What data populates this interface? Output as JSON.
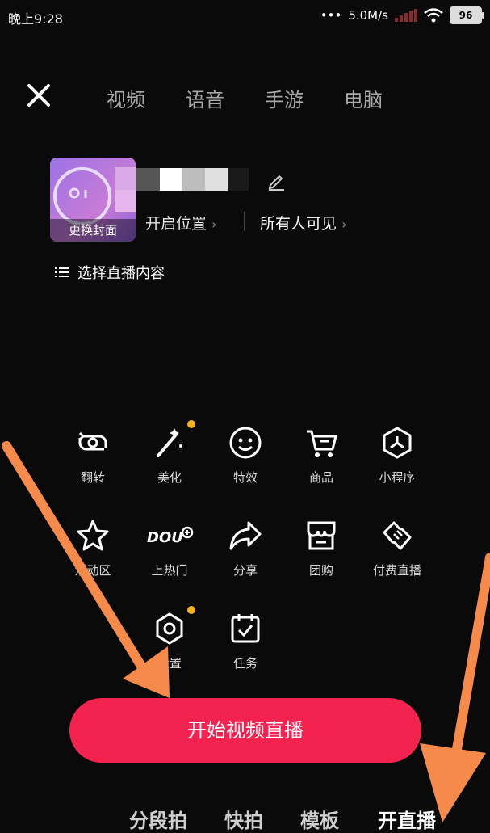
{
  "status": {
    "time": "晚上9:28",
    "network_speed": "5.0M/s",
    "battery": "96"
  },
  "top_tabs": [
    "视频",
    "语音",
    "手游",
    "电脑"
  ],
  "cover": {
    "label": "更换封面"
  },
  "info": {
    "location": "开启位置",
    "visibility": "所有人可见",
    "choose_content": "选择直播内容"
  },
  "tools": [
    {
      "label": "翻转",
      "icon": "flip-camera-icon"
    },
    {
      "label": "美化",
      "icon": "magic-wand-icon"
    },
    {
      "label": "特效",
      "icon": "smiley-effect-icon"
    },
    {
      "label": "商品",
      "icon": "shopping-cart-icon"
    },
    {
      "label": "小程序",
      "icon": "mini-program-icon"
    },
    {
      "label": "活动区",
      "icon": "star-icon"
    },
    {
      "label": "上热门",
      "icon": "dou-plus-icon"
    },
    {
      "label": "分享",
      "icon": "share-icon"
    },
    {
      "label": "团购",
      "icon": "store-icon"
    },
    {
      "label": "付费直播",
      "icon": "ticket-icon"
    },
    {
      "label": "设置",
      "icon": "settings-icon"
    },
    {
      "label": "任务",
      "icon": "task-calendar-icon"
    }
  ],
  "start_button": "开始视频直播",
  "bottom_tabs": [
    "分段拍",
    "快拍",
    "模板",
    "开直播"
  ],
  "colors": {
    "accent": "#f3224f",
    "badge": "#f6b31b",
    "arrow": "#f58a4a"
  }
}
